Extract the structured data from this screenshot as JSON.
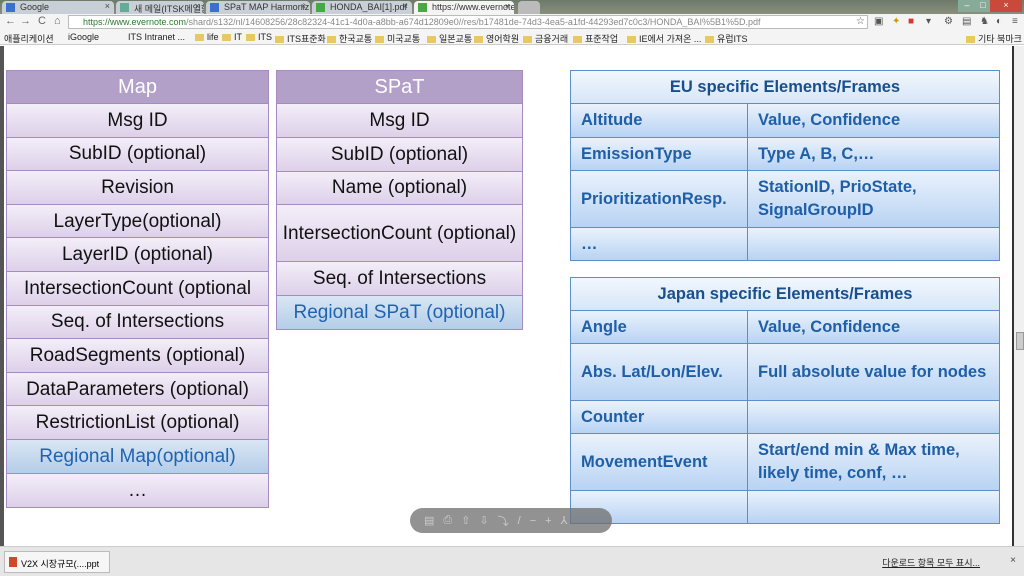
{
  "browser": {
    "tabs": [
      {
        "label": "Google"
      },
      {
        "label": "새 메일(ITSK메일함)"
      },
      {
        "label": "SPaT MAP Harmoniz"
      },
      {
        "label": "HONDA_BAI[1].pdf"
      },
      {
        "label": "https://www.evernote"
      }
    ],
    "url_host": "https://www.evernote.com",
    "url_path": "/shard/s132/nl/14608256/28c82324-41c1-4d0a-a8bb-a674d12809e0//res/b17481de-74d3-4ea5-a1fd-44293ed7c0c3/HONDA_BAI%5B1%5D.pdf",
    "bookmarks": [
      "애플리케이션",
      "iGoogle",
      "ITS Intranet ...",
      "life",
      "IT",
      "ITS",
      "ITS표준화",
      "한국교통",
      "미국교통",
      "일본교통",
      "영어학원",
      "금융거래",
      "표준작업",
      "IE에서 가져온 ...",
      "유럽ITS"
    ],
    "other_bookmarks": "기타 북마크"
  },
  "map_table": {
    "header": "Map",
    "rows": [
      "Msg ID",
      "SubID (optional)",
      "Revision",
      "LayerType(optional)",
      "LayerID (optional)",
      "IntersectionCount (optional",
      "Seq. of Intersections",
      "RoadSegments (optional)",
      "DataParameters (optional)",
      "RestrictionList (optional)",
      "Regional Map(optional)",
      "…"
    ]
  },
  "spat_table": {
    "header": "SPaT",
    "rows": [
      "Msg ID",
      "SubID (optional)",
      "Name (optional)",
      "IntersectionCount (optional)",
      "Seq. of Intersections",
      "Regional SPaT (optional)"
    ]
  },
  "eu_table": {
    "header": "EU specific Elements/Frames",
    "rows": [
      [
        "Altitude",
        "Value, Confidence"
      ],
      [
        "EmissionType",
        "Type A, B, C,…"
      ],
      [
        "PrioritizationResp.",
        "StationID, PrioState, SignalGroupID"
      ],
      [
        "…",
        ""
      ]
    ]
  },
  "japan_table": {
    "header": "Japan specific Elements/Frames",
    "rows": [
      [
        "Angle",
        "Value, Confidence"
      ],
      [
        "Abs. Lat/Lon/Elev.",
        "Full absolute value for nodes"
      ],
      [
        "Counter",
        ""
      ],
      [
        "MovementEvent",
        "Start/end min & Max time, likely time, conf, …"
      ],
      [
        "",
        ""
      ]
    ]
  },
  "downloads": {
    "item": "V2X 시장규모(....ppt",
    "show_all": "다운로드 항목 모두 표시..."
  },
  "colors": {
    "purple_header": "#b3a0c8",
    "blue_text": "#1f5fa8"
  }
}
